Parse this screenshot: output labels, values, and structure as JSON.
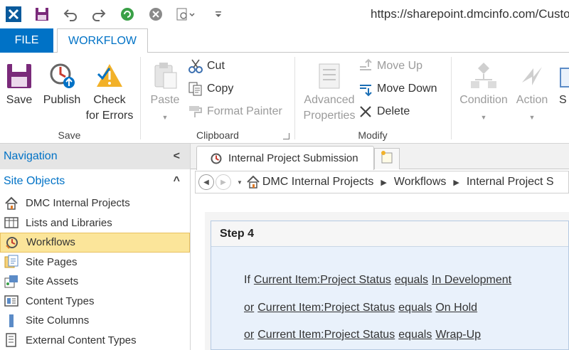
{
  "window": {
    "url": "https://sharepoint.dmcinfo.com/Custo"
  },
  "tabs": {
    "file": "FILE",
    "workflow": "WORKFLOW"
  },
  "ribbon": {
    "save_group": {
      "label": "Save",
      "save": "Save",
      "publish": "Publish",
      "check_line1": "Check",
      "check_line2": "for Errors"
    },
    "clipboard_group": {
      "label": "Clipboard",
      "paste": "Paste",
      "cut": "Cut",
      "copy": "Copy",
      "format_painter": "Format Painter"
    },
    "modify_group": {
      "label": "Modify",
      "advanced_line1": "Advanced",
      "advanced_line2": "Properties",
      "move_up": "Move Up",
      "move_down": "Move Down",
      "delete": "Delete"
    },
    "insert_group": {
      "condition": "Condition",
      "action": "Action",
      "step_partial": "S"
    }
  },
  "navigation": {
    "title": "Navigation",
    "collapse_glyph": "<",
    "section": "Site Objects",
    "section_glyph": "^",
    "items": [
      {
        "label": "DMC Internal Projects",
        "icon": "home-icon"
      },
      {
        "label": "Lists and Libraries",
        "icon": "list-icon"
      },
      {
        "label": "Workflows",
        "icon": "workflow-icon",
        "selected": true
      },
      {
        "label": "Site Pages",
        "icon": "pages-icon"
      },
      {
        "label": "Site Assets",
        "icon": "assets-icon"
      },
      {
        "label": "Content Types",
        "icon": "content-types-icon"
      },
      {
        "label": "Site Columns",
        "icon": "columns-icon"
      },
      {
        "label": "External Content Types",
        "icon": "external-content-icon"
      }
    ]
  },
  "document": {
    "tab_title": "Internal Project Submission",
    "breadcrumb": [
      "DMC Internal Projects",
      "Workflows",
      "Internal Project S"
    ],
    "step": {
      "title": "Step 4",
      "conditions": [
        {
          "keyword": "If",
          "field": "Current Item:Project Status",
          "op": "equals",
          "value": "In Development"
        },
        {
          "keyword": "or",
          "field": "Current Item:Project Status",
          "op": "equals",
          "value": "On Hold"
        },
        {
          "keyword": "or",
          "field": "Current Item:Project Status",
          "op": "equals",
          "value": "Wrap-Up"
        }
      ]
    }
  },
  "colors": {
    "accent": "#0072c6",
    "selected": "#fbe59a",
    "step_bg": "#e9f1fb"
  }
}
